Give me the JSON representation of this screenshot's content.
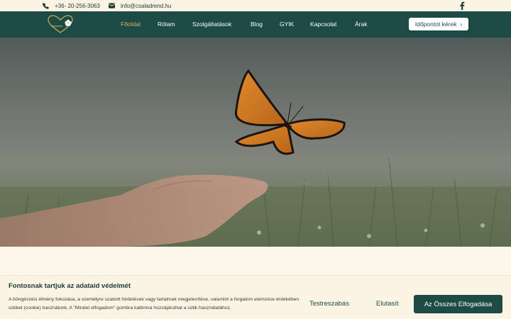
{
  "topbar": {
    "phone": "+36- 20-256-3063",
    "email": "info@csaladrend.hu"
  },
  "nav": {
    "items": [
      {
        "label": "Főoldal",
        "active": true
      },
      {
        "label": "Rólam"
      },
      {
        "label": "Szolgáltatások"
      },
      {
        "label": "Blog"
      },
      {
        "label": "GYIK"
      },
      {
        "label": "Kapcsolat"
      },
      {
        "label": "Árak"
      }
    ],
    "cta_label": "Időpontot kérek"
  },
  "cookie": {
    "title": "Fontosnak tartjuk az adataid védelmét",
    "text": "A böngészési élmény fokozása, a személyre szabott hirdetések vagy tartalmak megjelenítése, valamint a forgalom elemzése érdekében sütiket (cookie) használunk. A \"Mindet elfogadom\" gombra kattintva hozzájárulhat a sütik használatához.",
    "customize_label": "Testreszabás",
    "reject_label": "Elutasít",
    "accept_label": "Az Összes Elfogadása"
  },
  "colors": {
    "brand": "#1c4a44",
    "accent": "#d9b26a",
    "background": "#fdf6ea"
  }
}
